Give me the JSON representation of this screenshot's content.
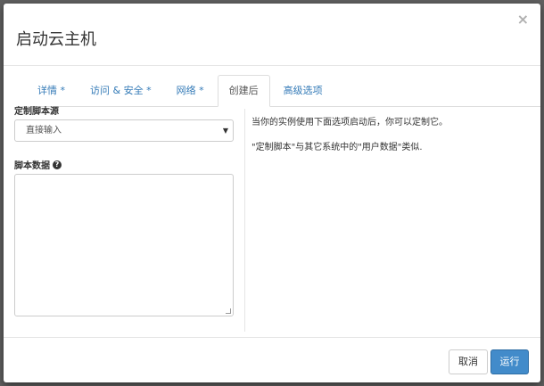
{
  "modal": {
    "title": "启动云主机",
    "close_glyph": "×"
  },
  "tabs": [
    {
      "label": "详情 *"
    },
    {
      "label": "访问 & 安全 *"
    },
    {
      "label": "网络 *"
    },
    {
      "label": "创建后",
      "active": true
    },
    {
      "label": "高级选项"
    }
  ],
  "form": {
    "script_source_label": "定制脚本源",
    "script_source_value": "直接输入",
    "script_data_label": "脚本数据",
    "help_icon": "question-circle-icon"
  },
  "help": {
    "line1": "当你的实例使用下面选项启动后，你可以定制它。",
    "line2": "\"定制脚本\"与其它系统中的\"用户数据\"类似."
  },
  "footer": {
    "cancel_label": "取消",
    "run_label": "运行"
  },
  "colors": {
    "primary": "#428bca",
    "link": "#337ab7"
  }
}
